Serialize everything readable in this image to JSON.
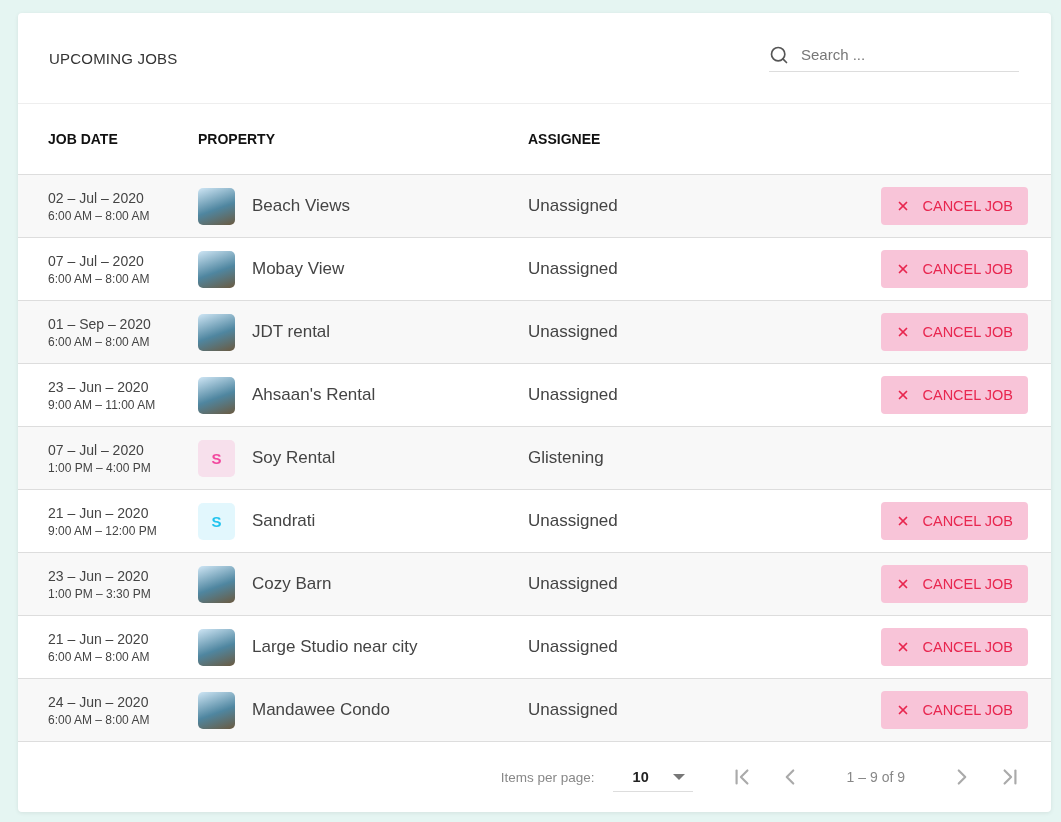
{
  "title": "UPCOMING JOBS",
  "search": {
    "placeholder": "Search ..."
  },
  "columns": [
    "JOB DATE",
    "PROPERTY",
    "ASSIGNEE"
  ],
  "rows": [
    {
      "date": "02 – Jul – 2020",
      "time": "6:00 AM – 8:00 AM",
      "thumb": {
        "kind": "photo"
      },
      "property": "Beach Views",
      "assignee": "Unassigned",
      "action": "CANCEL JOB"
    },
    {
      "date": "07 – Jul – 2020",
      "time": "6:00 AM – 8:00 AM",
      "thumb": {
        "kind": "photo"
      },
      "property": "Mobay View",
      "assignee": "Unassigned",
      "action": "CANCEL JOB"
    },
    {
      "date": "01 – Sep – 2020",
      "time": "6:00 AM – 8:00 AM",
      "thumb": {
        "kind": "photo"
      },
      "property": "JDT rental",
      "assignee": "Unassigned",
      "action": "CANCEL JOB"
    },
    {
      "date": "23 – Jun – 2020",
      "time": "9:00 AM – 11:00 AM",
      "thumb": {
        "kind": "photo"
      },
      "property": "Ahsaan's Rental",
      "assignee": "Unassigned",
      "action": "CANCEL JOB"
    },
    {
      "date": "07 – Jul – 2020",
      "time": "1:00 PM – 4:00 PM",
      "thumb": {
        "kind": "letter",
        "letter": "S",
        "color": "#f2479e"
      },
      "property": "Soy Rental",
      "assignee": "Glistening"
    },
    {
      "date": "21 – Jun – 2020",
      "time": "9:00 AM – 12:00 PM",
      "thumb": {
        "kind": "letter",
        "letter": "S",
        "color": "#22c3ee"
      },
      "property": "Sandrati",
      "assignee": "Unassigned",
      "action": "CANCEL JOB"
    },
    {
      "date": "23 – Jun – 2020",
      "time": "1:00 PM – 3:30 PM",
      "thumb": {
        "kind": "photo"
      },
      "property": "Cozy Barn",
      "assignee": "Unassigned",
      "action": "CANCEL JOB"
    },
    {
      "date": "21 – Jun – 2020",
      "time": "6:00 AM – 8:00 AM",
      "thumb": {
        "kind": "photo"
      },
      "property": "Large Studio near city",
      "assignee": "Unassigned",
      "action": "CANCEL JOB"
    },
    {
      "date": "24 – Jun – 2020",
      "time": "6:00 AM – 8:00 AM",
      "thumb": {
        "kind": "photo"
      },
      "property": "Mandawee Condo",
      "assignee": "Unassigned",
      "action": "CANCEL JOB"
    }
  ],
  "paginator": {
    "label": "Items per page:",
    "page_size": "10",
    "range": "1 – 9 of 9"
  }
}
